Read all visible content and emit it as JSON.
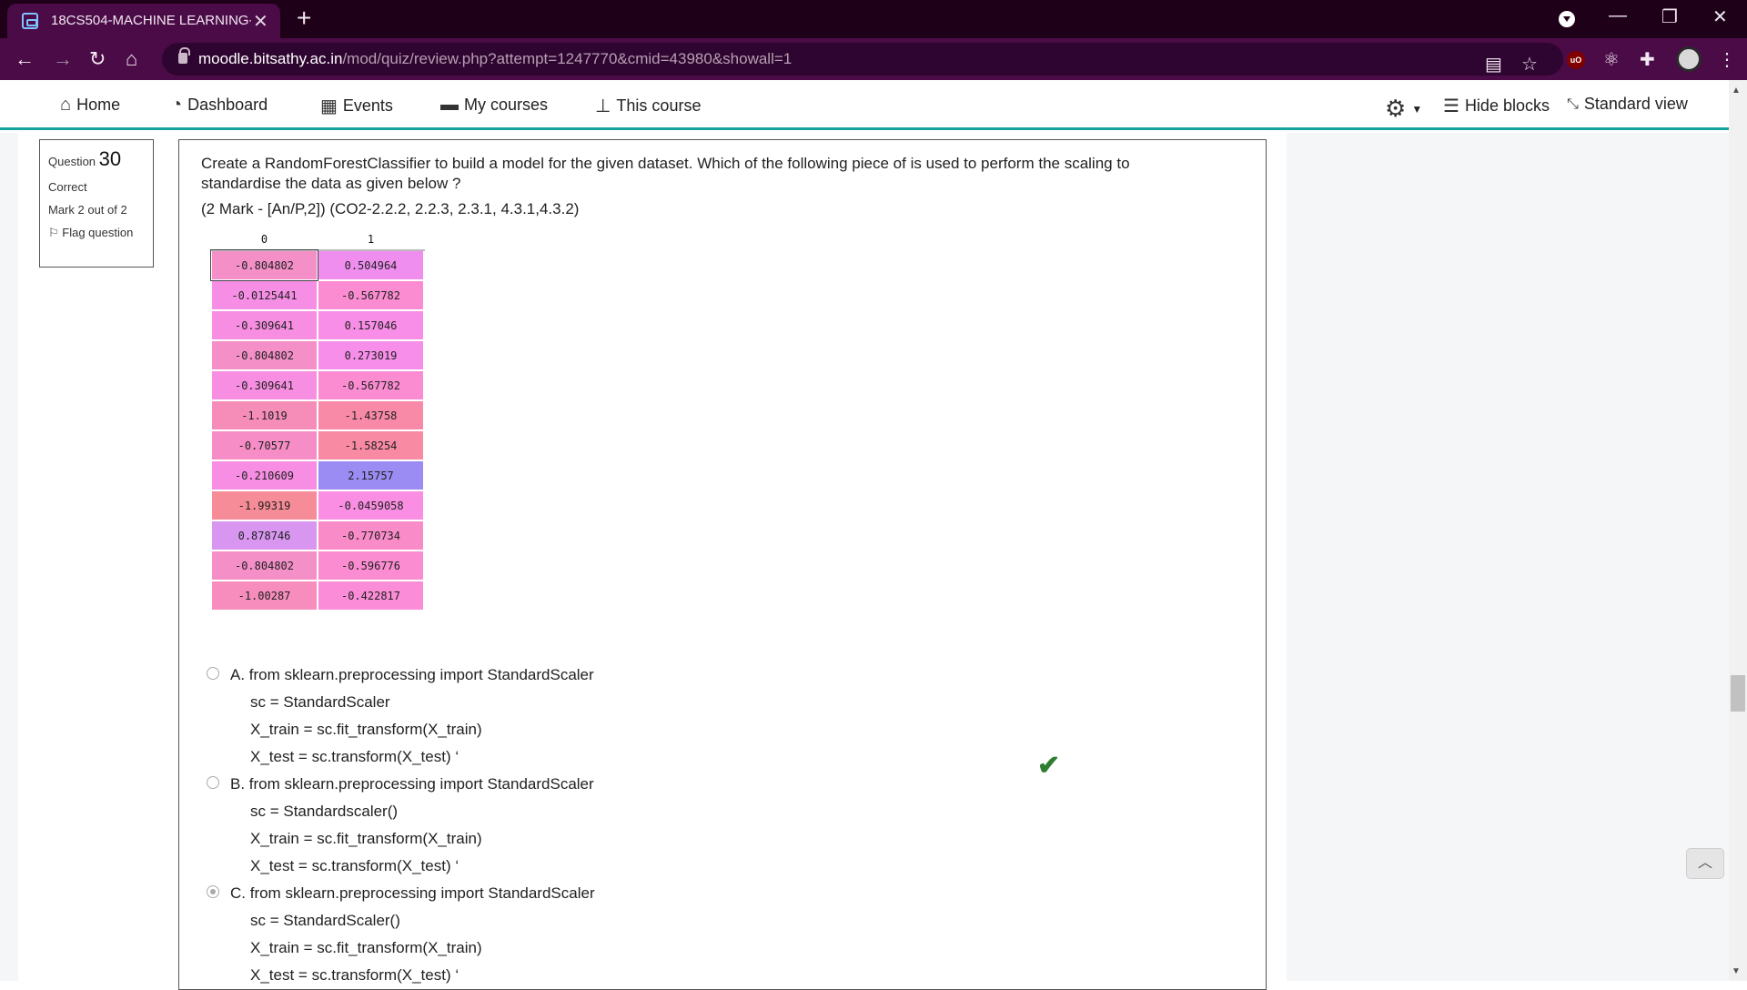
{
  "browser": {
    "tab_title": "18CS504-MACHINE LEARNING-2",
    "url_host": "moodle.bitsathy.ac.in",
    "url_path": "/mod/quiz/review.php?attempt=1247770&cmid=43980&showall=1"
  },
  "navbar": {
    "home": "Home",
    "dashboard": "Dashboard",
    "events": "Events",
    "my_courses": "My courses",
    "this_course": "This course",
    "hide_blocks": "Hide blocks",
    "standard_view": "Standard view"
  },
  "question_info": {
    "label": "Question",
    "number": "30",
    "state": "Correct",
    "mark": "Mark 2 out of 2",
    "flag": "Flag question"
  },
  "question": {
    "text": "Create a RandomForestClassifier to build a model for the given dataset. Which of the following piece of is used to perform the scaling to standardise the data as given below ?",
    "mark_info": "(2 Mark - [An/P,2]) (CO2-2.2.2, 2.2.3, 2.3.1, 4.3.1,4.3.2)"
  },
  "data_table": {
    "headers": [
      "0",
      "1"
    ],
    "rows": [
      [
        {
          "v": "-0.804802",
          "c": "#f48fc8"
        },
        {
          "v": "0.504964",
          "c": "#f08ef0"
        }
      ],
      [
        {
          "v": "-0.0125441",
          "c": "#f78ee6"
        },
        {
          "v": "-0.567782",
          "c": "#fb8cd2"
        }
      ],
      [
        {
          "v": "-0.309641",
          "c": "#f88ee2"
        },
        {
          "v": "0.157046",
          "c": "#f98ee8"
        }
      ],
      [
        {
          "v": "-0.804802",
          "c": "#f48fc8"
        },
        {
          "v": "0.273019",
          "c": "#f78ee9"
        }
      ],
      [
        {
          "v": "-0.309641",
          "c": "#f88ee2"
        },
        {
          "v": "-0.567782",
          "c": "#fb8cd2"
        }
      ],
      [
        {
          "v": "-1.1019",
          "c": "#f68db9"
        },
        {
          "v": "-1.43758",
          "c": "#f88aa8"
        }
      ],
      [
        {
          "v": "-0.70577",
          "c": "#f68dc6"
        },
        {
          "v": "-1.58254",
          "c": "#f88aa4"
        }
      ],
      [
        {
          "v": "-0.210609",
          "c": "#f88ee4"
        },
        {
          "v": "2.15757",
          "c": "#9a8cf2"
        }
      ],
      [
        {
          "v": "-1.99319",
          "c": "#f68c98"
        },
        {
          "v": "-0.0459058",
          "c": "#f98ee3"
        }
      ],
      [
        {
          "v": "0.878746",
          "c": "#d896f0"
        },
        {
          "v": "-0.770734",
          "c": "#f98bc8"
        }
      ],
      [
        {
          "v": "-0.804802",
          "c": "#f48fc8"
        },
        {
          "v": "-0.596776",
          "c": "#fb8cd1"
        }
      ],
      [
        {
          "v": "-1.00287",
          "c": "#f68dbd"
        },
        {
          "v": "-0.422817",
          "c": "#fb8cd7"
        }
      ]
    ]
  },
  "options": [
    {
      "first": "A. from sklearn.preprocessing import StandardScaler",
      "lines": [
        "sc = StandardScaler",
        "X_train = sc.fit_transform(X_train)",
        "X_test = sc.transform(X_test) ‘"
      ]
    },
    {
      "first": "B. from sklearn.preprocessing import StandardScaler",
      "lines": [
        "sc = Standardscaler()",
        "X_train = sc.fit_transform(X_train)",
        "X_test = sc.transform(X_test) ‘"
      ]
    },
    {
      "first": "C. from sklearn.preprocessing import StandardScaler",
      "lines": [
        "sc = StandardScaler()",
        "X_train = sc.fit_transform(X_train)",
        "X_test = sc.transform(X_test) ‘"
      ]
    }
  ],
  "selected_option": 2,
  "icons": {
    "correct": "checkmark-icon",
    "back_to_top": "chevron-up-icon"
  },
  "colors": {
    "tabbar": "#1e0118",
    "addrbar": "#4a0b47",
    "navbar_accent": "#16a39d",
    "correct": "#2e7d32"
  }
}
